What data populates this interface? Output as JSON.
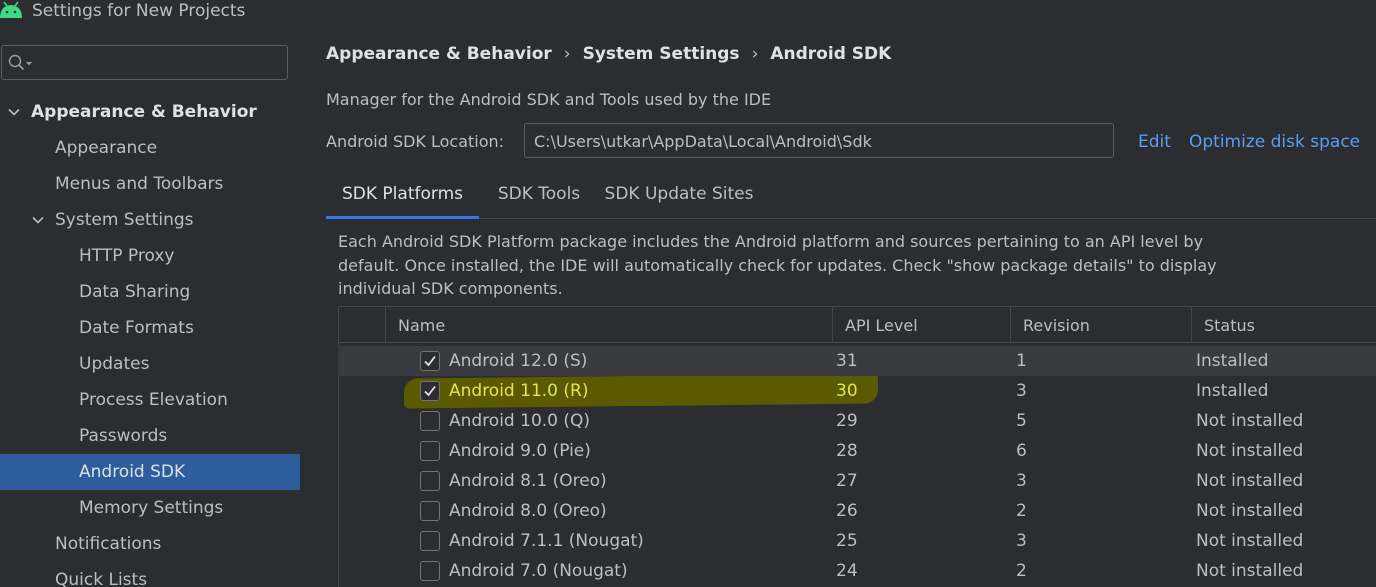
{
  "window": {
    "title": "Settings for New Projects"
  },
  "sidebar": {
    "search": {
      "value": ""
    },
    "items": [
      {
        "label": "Appearance & Behavior"
      },
      {
        "label": "Appearance"
      },
      {
        "label": "Menus and Toolbars"
      },
      {
        "label": "System Settings"
      },
      {
        "label": "HTTP Proxy"
      },
      {
        "label": "Data Sharing"
      },
      {
        "label": "Date Formats"
      },
      {
        "label": "Updates"
      },
      {
        "label": "Process Elevation"
      },
      {
        "label": "Passwords"
      },
      {
        "label": "Android SDK"
      },
      {
        "label": "Memory Settings"
      },
      {
        "label": "Notifications"
      },
      {
        "label": "Quick Lists"
      }
    ]
  },
  "main": {
    "breadcrumb": [
      "Appearance & Behavior",
      "System Settings",
      "Android SDK"
    ],
    "description": "Manager for the Android SDK and Tools used by the IDE",
    "location_label": "Android SDK Location:",
    "location_value": "C:\\Users\\utkar\\AppData\\Local\\Android\\Sdk",
    "edit_link": "Edit",
    "optimize_link": "Optimize disk space",
    "tabs": [
      {
        "label": "SDK Platforms",
        "active": true
      },
      {
        "label": "SDK Tools",
        "active": false
      },
      {
        "label": "SDK Update Sites",
        "active": false
      }
    ],
    "panel_description": "Each Android SDK Platform package includes the Android platform and sources pertaining to an API level by default. Once installed, the IDE will automatically check for updates. Check \"show package details\" to display individual SDK components.",
    "table": {
      "headers": {
        "name": "Name",
        "api": "API Level",
        "revision": "Revision",
        "status": "Status"
      },
      "rows": [
        {
          "checked": true,
          "name": "Android 12.0 (S)",
          "api": "31",
          "revision": "1",
          "status": "Installed"
        },
        {
          "checked": true,
          "name": "Android 11.0 (R)",
          "api": "30",
          "revision": "3",
          "status": "Installed"
        },
        {
          "checked": false,
          "name": "Android 10.0 (Q)",
          "api": "29",
          "revision": "5",
          "status": "Not installed"
        },
        {
          "checked": false,
          "name": "Android 9.0 (Pie)",
          "api": "28",
          "revision": "6",
          "status": "Not installed"
        },
        {
          "checked": false,
          "name": "Android 8.1 (Oreo)",
          "api": "27",
          "revision": "3",
          "status": "Not installed"
        },
        {
          "checked": false,
          "name": "Android 8.0 (Oreo)",
          "api": "26",
          "revision": "2",
          "status": "Not installed"
        },
        {
          "checked": false,
          "name": "Android 7.1.1 (Nougat)",
          "api": "25",
          "revision": "3",
          "status": "Not installed"
        },
        {
          "checked": false,
          "name": "Android 7.0 (Nougat)",
          "api": "24",
          "revision": "2",
          "status": "Not installed"
        }
      ]
    }
  },
  "colors": {
    "background": "#2b2d30",
    "selection": "#2e5d9e",
    "link": "#589df6",
    "tab_underline": "#3574f0",
    "highlighter": "#5c5a00",
    "highlight_text": "#e5e54c",
    "android_green": "#3ddc84"
  },
  "icons": [
    "android-icon",
    "search-icon",
    "chevron-down-icon",
    "checkbox-check-icon"
  ]
}
